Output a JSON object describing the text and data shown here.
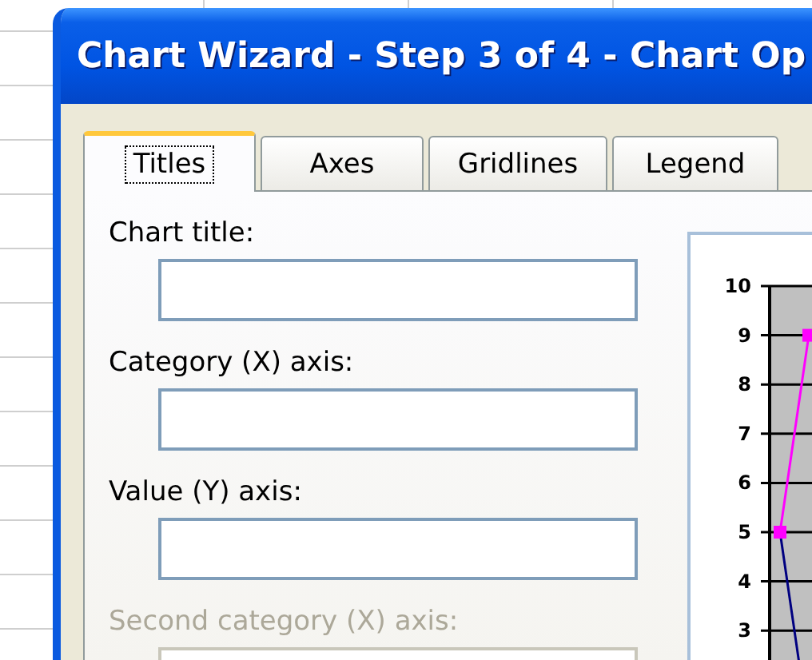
{
  "window": {
    "title": "Chart Wizard - Step 3 of 4 - Chart Op"
  },
  "tabs": [
    {
      "label": "Titles",
      "selected": true
    },
    {
      "label": "Axes",
      "selected": false
    },
    {
      "label": "Gridlines",
      "selected": false
    },
    {
      "label": "Legend",
      "selected": false
    }
  ],
  "fields": [
    {
      "label": "Chart title:",
      "disabled": false
    },
    {
      "label": "Category (X) axis:",
      "disabled": false
    },
    {
      "label": "Value (Y) axis:",
      "disabled": false
    },
    {
      "label": "Second category (X) axis:",
      "disabled": true
    }
  ],
  "preview": {
    "y_tick_labels": [
      "10",
      "9",
      "8",
      "7",
      "6",
      "5",
      "4",
      "3"
    ]
  }
}
